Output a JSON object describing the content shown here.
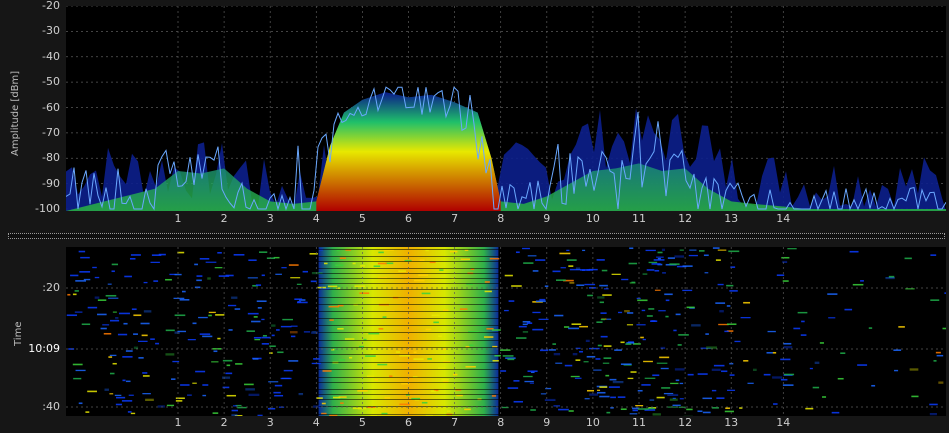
{
  "colors": {
    "background": "#161616",
    "plot_background": "#000000",
    "grid": "#5a5a5a",
    "max_hold_line": "#6aa8ff",
    "density_low": "#0a1a8a",
    "density_mid": "#1fbf6a",
    "density_high": "#e8e800",
    "density_peak": "#b00000"
  },
  "spectrum": {
    "ylabel": "Amplitude [dBm]",
    "y_ticks": [
      "-20",
      "-30",
      "-40",
      "-50",
      "-60",
      "-70",
      "-80",
      "-90",
      "-100"
    ],
    "x_ticks": [
      "1",
      "2",
      "3",
      "4",
      "5",
      "6",
      "7",
      "8",
      "9",
      "10",
      "11",
      "12",
      "13",
      "14"
    ]
  },
  "waterfall": {
    "ylabel": "Time",
    "y_ticks": [
      ":20",
      "10:09",
      ":40"
    ],
    "x_ticks": [
      "1",
      "2",
      "3",
      "4",
      "5",
      "6",
      "7",
      "8",
      "9",
      "10",
      "11",
      "12",
      "13",
      "14"
    ]
  },
  "chart_data": [
    {
      "type": "area",
      "title": "",
      "xlabel": "",
      "ylabel": "Amplitude [dBm]",
      "x_axis": "channel",
      "ylim": [
        -100,
        -20
      ],
      "grid": true,
      "series": [
        {
          "name": "",
          "x": [
            0.5,
            1,
            1.5,
            2,
            2.5,
            3,
            3.5,
            4,
            4.3,
            4.6,
            5,
            5.5,
            6,
            6.5,
            7,
            7.5,
            7.8,
            8,
            8.5,
            9,
            9.5,
            10,
            10.5,
            11,
            11.5,
            12,
            12.5,
            13,
            13.5,
            14,
            14.5
          ],
          "values": [
            -92,
            -85,
            -86,
            -84,
            -92,
            -97,
            -98,
            -97,
            -75,
            -62,
            -57,
            -54,
            -56,
            -55,
            -58,
            -62,
            -80,
            -97,
            -98,
            -95,
            -90,
            -85,
            -84,
            -82,
            -85,
            -84,
            -92,
            -97,
            -98,
            -99,
            -100
          ]
        }
      ]
    },
    {
      "type": "heatmap",
      "title": "",
      "ylabel": "Time",
      "x_axis": "channel",
      "y_ticks": [
        ":20",
        "10:09",
        ":40"
      ]
    }
  ]
}
